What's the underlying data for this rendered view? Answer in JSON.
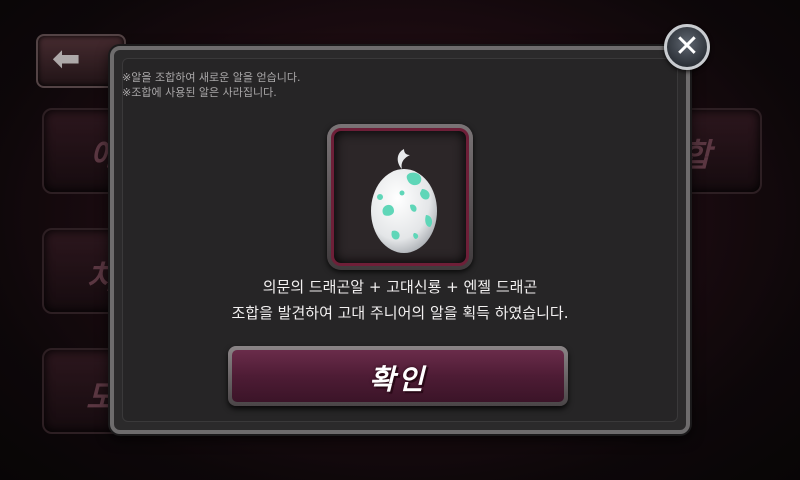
{
  "background": {
    "left_buttons": [
      {
        "label": "에인"
      },
      {
        "label": "치유"
      },
      {
        "label": "도박"
      }
    ],
    "right_button": {
      "label": "조합"
    }
  },
  "modal": {
    "notes": [
      "※알을 조합하여 새로운 알을 얻습니다.",
      "※조합에 사용된 알은 사라집니다."
    ],
    "result_item": {
      "icon": "dragon-egg-icon",
      "name": "고대 주니어의 알"
    },
    "message_line1": "의문의 드래곤알 + 고대신룡 + 엔젤 드래곤",
    "message_line2": "조합을 발견하여 고대 주니어의 알을 획득 하였습니다.",
    "confirm_label": "확인",
    "close_icon": "✕"
  },
  "colors": {
    "accent_frame": "#6e1f38",
    "egg_spots": "#5fd6b8",
    "confirm_button": "#5a2240"
  }
}
